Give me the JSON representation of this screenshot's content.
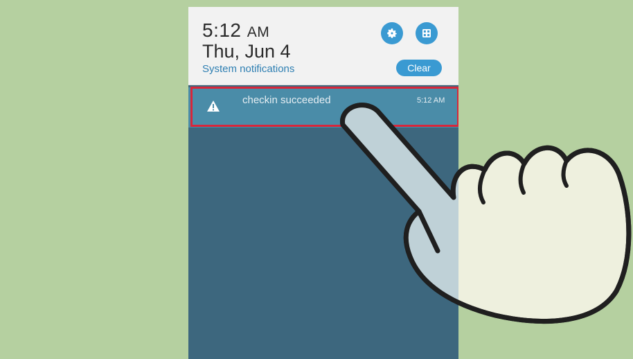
{
  "status": {
    "time": "5:12",
    "ampm": "AM",
    "date": "Thu, Jun 4"
  },
  "header": {
    "system_notifications": "System notifications",
    "clear_label": "Clear"
  },
  "notification": {
    "title": "checkin succeeded",
    "time": "5:12 AM"
  },
  "icons": {
    "settings": "gear-icon",
    "grid": "quick-settings-icon",
    "warning": "warning-icon",
    "hand": "pointing-hand-icon"
  },
  "colors": {
    "background": "#b5d0a0",
    "shade_bg": "#3d677e",
    "header_bg": "#f2f2f2",
    "accent": "#3a9ad2",
    "highlight": "#d8263a"
  }
}
